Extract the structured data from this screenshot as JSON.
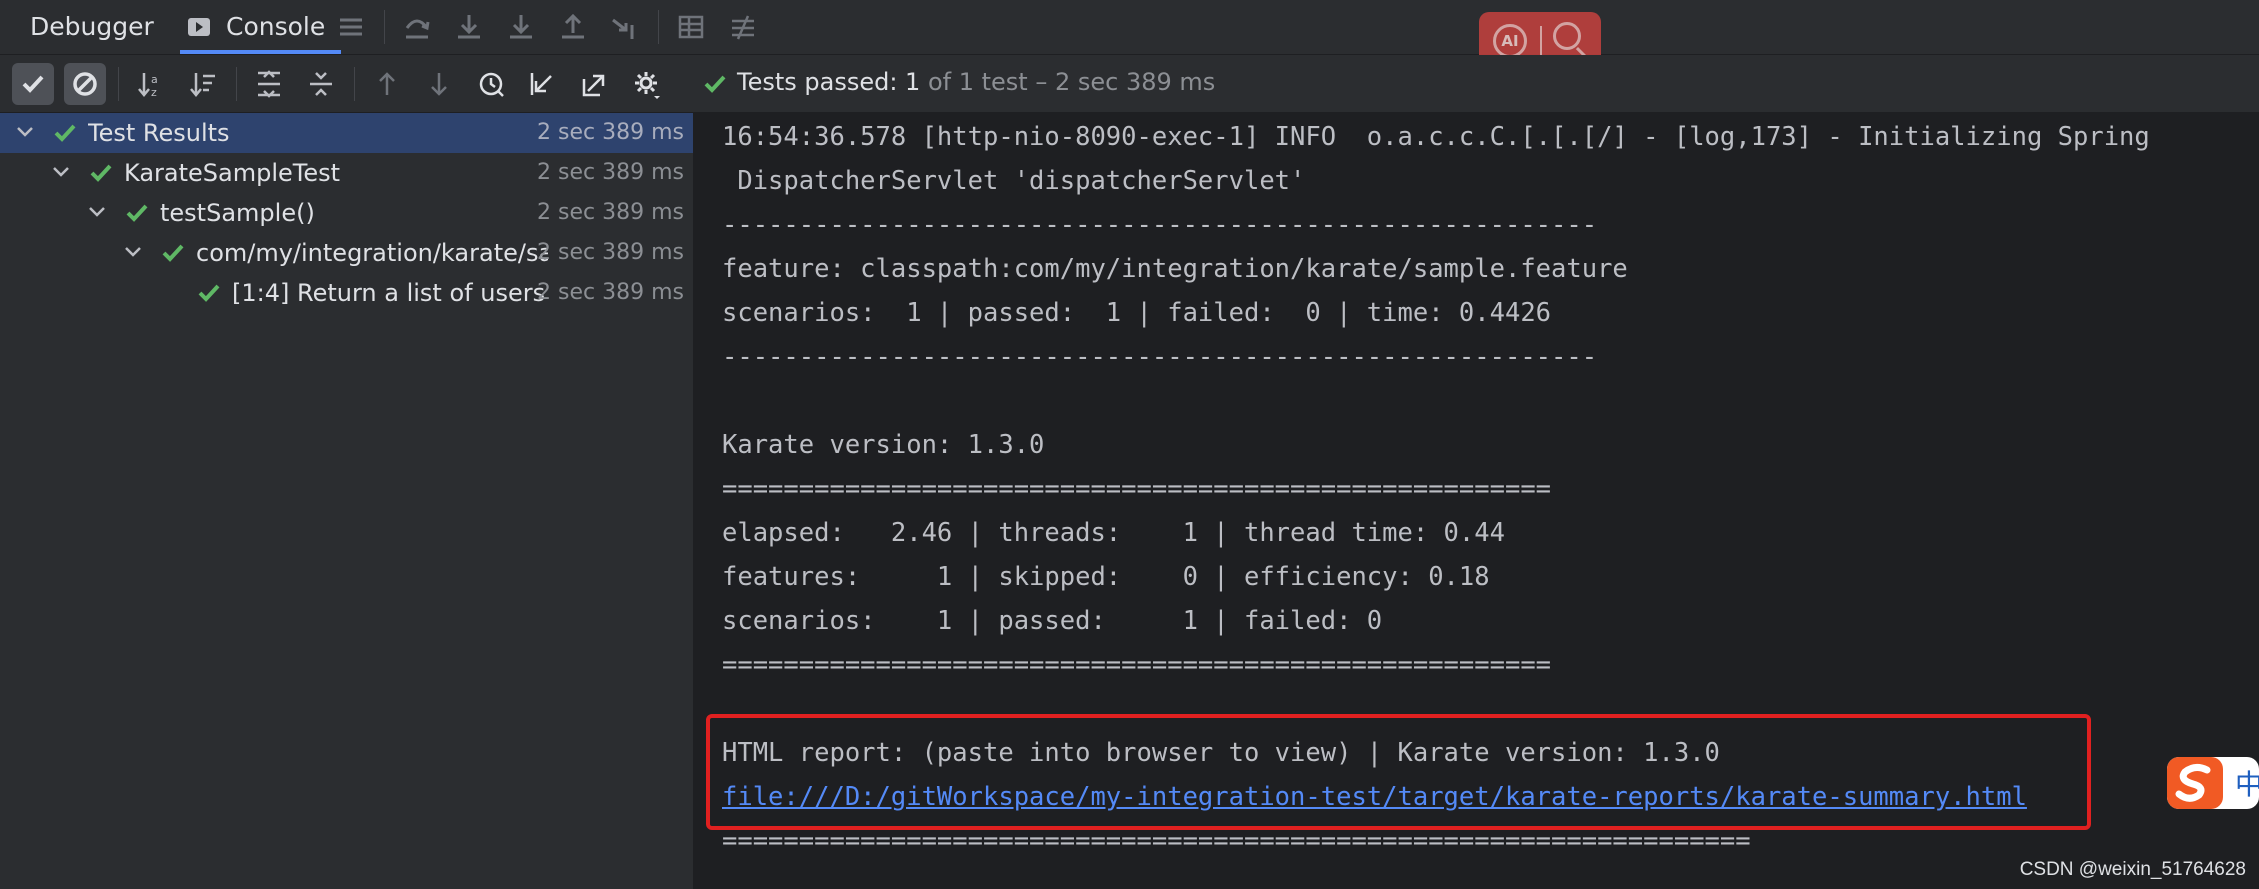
{
  "tabs": {
    "debugger": "Debugger",
    "console": "Console"
  },
  "ai_widget": {
    "badge": "AI"
  },
  "status": {
    "passed_label": "Tests passed: 1",
    "detail": "of 1 test – 2 sec 389 ms"
  },
  "tree": [
    {
      "label": "Test Results",
      "time": "2 sec 389 ms",
      "selected": true
    },
    {
      "label": "KarateSampleTest",
      "time": "2 sec 389 ms"
    },
    {
      "label": "testSample()",
      "time": "2 sec 389 ms"
    },
    {
      "label": "com/my/integration/karate/sample",
      "time": "2 sec 389 ms"
    },
    {
      "label": "[1:4] Return a list of users",
      "time": "2 sec 389 ms"
    }
  ],
  "console": {
    "lines": [
      "16:54:36.578 [http-nio-8090-exec-1] INFO  o.a.c.c.C.[.[.[/] - [log,173] - Initializing Spring",
      " DispatcherServlet 'dispatcherServlet'",
      "---------------------------------------------------------",
      "feature: classpath:com/my/integration/karate/sample.feature",
      "scenarios:  1 | passed:  1 | failed:  0 | time: 0.4426",
      "---------------------------------------------------------",
      "",
      "Karate version: 1.3.0",
      "======================================================",
      "elapsed:   2.46 | threads:    1 | thread time: 0.44",
      "features:     1 | skipped:    0 | efficiency: 0.18",
      "scenarios:    1 | passed:     1 | failed: 0",
      "======================================================",
      "",
      "HTML report: (paste into browser to view) | Karate version: 1.3.0"
    ],
    "report_link": "file:///D:/gitWorkspace/my-integration-test/target/karate-reports/karate-summary.html",
    "closing_rule": "==================================================================="
  },
  "ime": {
    "label": "中"
  },
  "watermark": "CSDN @weixin_51764628",
  "colors": {
    "accent": "#548af7",
    "success": "#5fb865",
    "highlight_box": "#e02020",
    "selection": "#2e436e"
  }
}
